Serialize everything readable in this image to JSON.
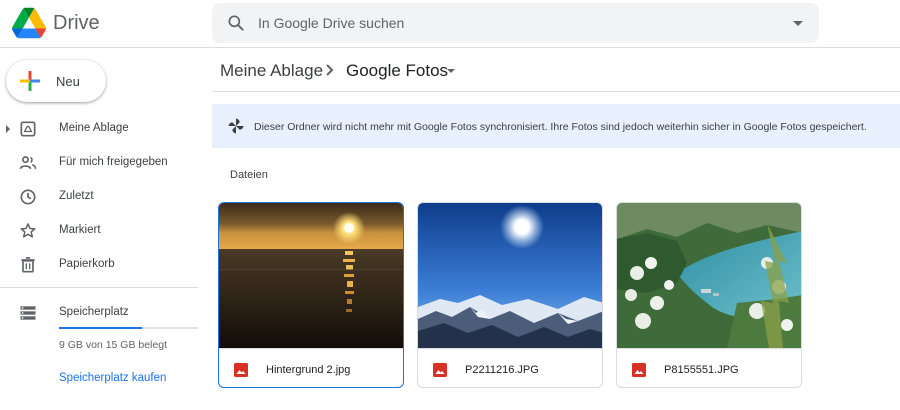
{
  "header": {
    "brand": "Drive",
    "search": {
      "placeholder": "In Google Drive suchen",
      "value": ""
    }
  },
  "sidebar": {
    "new_label": "Neu",
    "items": [
      {
        "label": "Meine Ablage",
        "icon": "my-drive-icon"
      },
      {
        "label": "Für mich freigegeben",
        "icon": "shared-people-icon"
      },
      {
        "label": "Zuletzt",
        "icon": "clock-icon"
      },
      {
        "label": "Markiert",
        "icon": "star-icon"
      },
      {
        "label": "Papierkorb",
        "icon": "trash-icon"
      }
    ],
    "storage": {
      "label": "Speicherplatz",
      "used_text": "9 GB von 15 GB belegt",
      "used_fraction": 0.6,
      "buy_label": "Speicherplatz kaufen"
    }
  },
  "main": {
    "breadcrumb": {
      "root": "Meine Ablage",
      "current": "Google Fotos"
    },
    "banner": {
      "icon": "pinwheel-icon",
      "text": "Dieser Ordner wird nicht mehr mit Google Fotos synchronisiert. Ihre Fotos sind jedoch weiterhin sicher in Google Fotos gespeichert."
    },
    "section_title": "Dateien",
    "files": [
      {
        "name": "Hintergrund 2.jpg",
        "icon": "image-file-icon",
        "selected": true
      },
      {
        "name": "P2211216.JPG",
        "icon": "image-file-icon",
        "selected": false
      },
      {
        "name": "P8155551.JPG",
        "icon": "image-file-icon",
        "selected": false
      }
    ]
  },
  "colors": {
    "accent": "#1a73e8",
    "banner_bg": "#e8f0fe",
    "file_icon_red": "#d93025",
    "search_bg": "#f1f3f4"
  }
}
